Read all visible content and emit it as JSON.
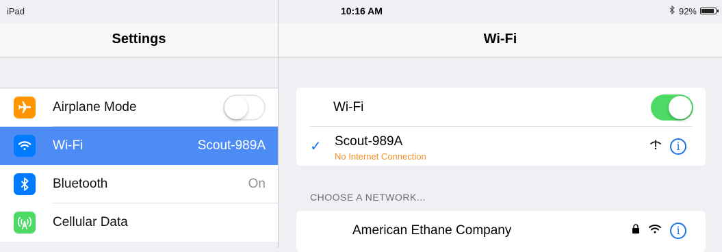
{
  "status_bar": {
    "device": "iPad",
    "time": "10:16 AM",
    "battery": "92%"
  },
  "left": {
    "title": "Settings",
    "items": [
      {
        "label": "Airplane Mode",
        "icon": "airplane-icon",
        "color": "#ff9500",
        "toggle": false
      },
      {
        "label": "Wi-Fi",
        "icon": "wifi-icon",
        "color": "#007aff",
        "value": "Scout-989A",
        "selected": true
      },
      {
        "label": "Bluetooth",
        "icon": "bluetooth-icon",
        "color": "#007aff",
        "value": "On"
      },
      {
        "label": "Cellular Data",
        "icon": "cellular-icon",
        "color": "#4cd964"
      }
    ]
  },
  "right": {
    "title": "Wi-Fi",
    "wifi_toggle_label": "Wi-Fi",
    "wifi_on": true,
    "connected": {
      "name": "Scout-989A",
      "status": "No Internet Connection"
    },
    "section_header": "CHOOSE A NETWORK...",
    "networks": [
      {
        "name": "American Ethane Company",
        "locked": true
      }
    ]
  },
  "colors": {
    "accent": "#1a73e8",
    "selected_row": "#4d8bf5",
    "toggle_on": "#4cd964",
    "warning": "#f0902a"
  }
}
